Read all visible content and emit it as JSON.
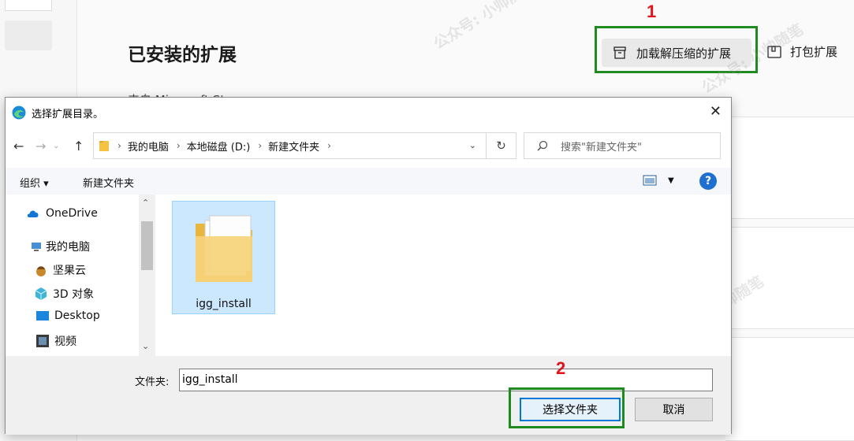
{
  "browser": {
    "page_title": "已安装的扩展",
    "subtitle": "来自 Microsoft Store",
    "load_unpacked_label": "加载解压缩的扩展",
    "pack_label": "打包扩展"
  },
  "annotations": {
    "step1": "1",
    "step2": "2",
    "highlight_color": "#1f8a1f",
    "number_color": "#e0151b"
  },
  "dialog": {
    "title": "选择扩展目录。",
    "close_glyph": "✕",
    "address": {
      "seg1": "我的电脑",
      "seg2": "本地磁盘 (D:)",
      "seg3": "新建文件夹"
    },
    "search_placeholder": "搜索\"新建文件夹\"",
    "toolbar": {
      "organize": "组织 ▾",
      "new_folder": "新建文件夹",
      "help": "?"
    },
    "nav_items": [
      {
        "label": "OneDrive",
        "icon": "cloud-icon"
      },
      {
        "label": "我的电脑",
        "icon": "computer-icon"
      },
      {
        "label": "坚果云",
        "icon": "nut-icon"
      },
      {
        "label": "3D 对象",
        "icon": "cube-icon"
      },
      {
        "label": "Desktop",
        "icon": "desktop-icon"
      },
      {
        "label": "视频",
        "icon": "film-icon"
      }
    ],
    "folder": {
      "name": "igg_install"
    },
    "footer": {
      "folder_label": "文件夹:",
      "folder_value": "igg_install",
      "select_button": "选择文件夹",
      "cancel_button": "取消"
    }
  },
  "watermark_text": "公众号: 小帅随笔"
}
